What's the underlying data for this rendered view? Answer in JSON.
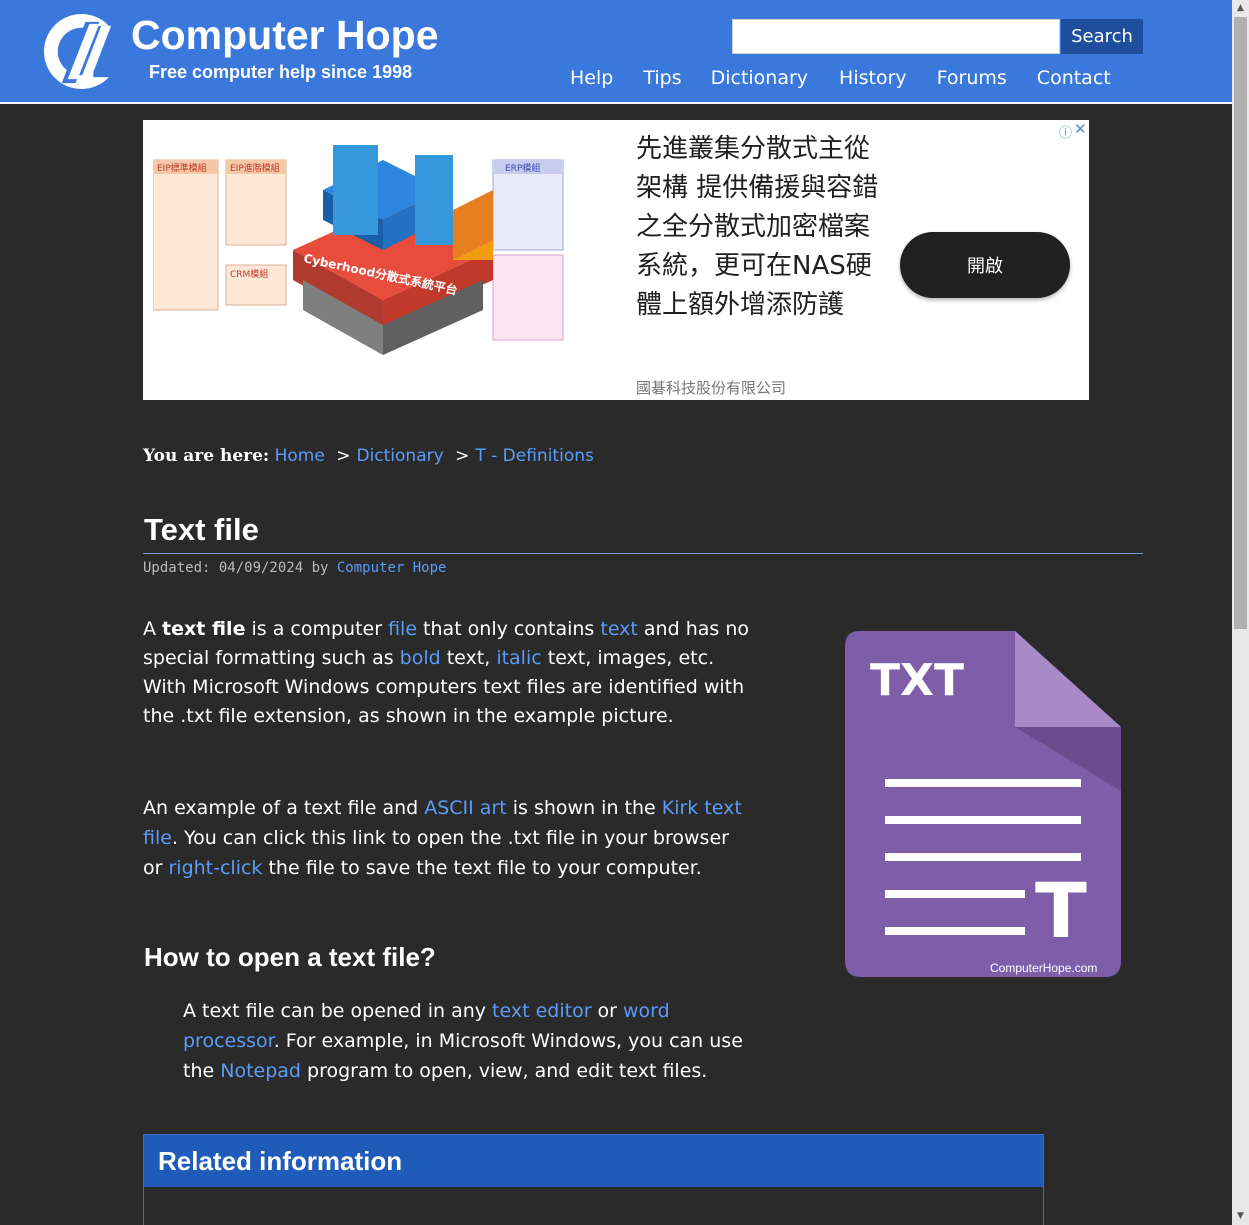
{
  "header": {
    "site_title": "Computer Hope",
    "tagline": "Free computer help since 1998",
    "search_button": "Search",
    "search_value": "",
    "nav": [
      "Help",
      "Tips",
      "Dictionary",
      "History",
      "Forums",
      "Contact"
    ]
  },
  "ad": {
    "image_labels": {
      "eip_standard": "EIP標準模組",
      "eip_advanced": "EIP進階模組",
      "erp_module": "ERP模組",
      "crm_module": "CRM模組",
      "platform": "Cyberhood分散式系統平台"
    },
    "text": "先進叢集分散式主從架構 提供備援與容錯之全分散式加密檔案系統，更可在NAS硬體上額外增添防護",
    "company": "國碁科技股份有限公司",
    "button": "開啟",
    "info_icon": "ⓘ",
    "close_icon": "✕"
  },
  "breadcrumb": {
    "label": "You are here:",
    "items": [
      "Home",
      "Dictionary",
      "T - Definitions"
    ],
    "separator": ">"
  },
  "article": {
    "title": "Text file",
    "updated_prefix": "Updated: 04/09/2024 by",
    "updated_author": "Computer Hope",
    "para1": {
      "t1": "A ",
      "bold": "text file",
      "t2": " is a computer ",
      "link_file": "file",
      "t3": " that only contains ",
      "link_text": "text",
      "t4": " and has no special formatting such as ",
      "link_bold": "bold",
      "t5": " text, ",
      "link_italic": "italic",
      "t6": " text, images, etc. With Microsoft Windows computers text files are identified with the .txt file extension, as shown in the example picture."
    },
    "para2": {
      "t1": "An example of a text file and ",
      "link_ascii": "ASCII art",
      "t2": " is shown in the ",
      "link_kirk": "Kirk text file",
      "t3": ". You can click this link to open the .txt file in your browser or ",
      "link_rightclick": "right-click",
      "t4": " the file to save the text file to your computer."
    },
    "h2": "How to open a text file?",
    "para3": {
      "t1": "A text file can be opened in any ",
      "link_editor": "text editor",
      "t2": " or ",
      "link_wp": "word processor",
      "t3": ". For example, in Microsoft Windows, you can use the ",
      "link_notepad": "Notepad",
      "t4": " program to open, view, and edit text files."
    },
    "image": {
      "label": "TXT",
      "letter": "T",
      "credit": "ComputerHope.com",
      "colors": {
        "body": "#7e5ea8",
        "fold": "#a98ac9",
        "shadow": "#6a4b8e"
      }
    }
  },
  "related": {
    "title": "Related information"
  },
  "colors": {
    "header_bg": "#3a78db",
    "page_bg": "#2a2a2a",
    "link": "#5a9cf8",
    "related_header": "#1f5bb8"
  }
}
